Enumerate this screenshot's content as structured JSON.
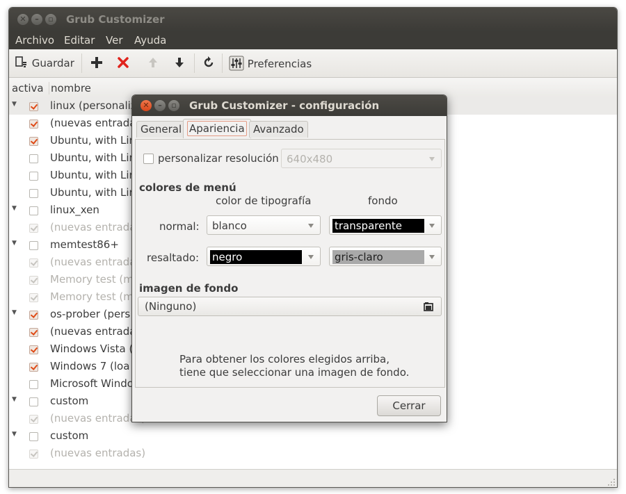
{
  "main_window": {
    "title": "Grub Customizer",
    "menu": [
      "Archivo",
      "Editar",
      "Ver",
      "Ayuda"
    ],
    "toolbar": {
      "save_label": "Guardar",
      "preferences_label": "Preferencias"
    },
    "columns": {
      "active": "activa",
      "name": "nombre"
    },
    "rows": [
      {
        "label": "linux (personaliz",
        "checked": true,
        "disabled": false,
        "expander": true
      },
      {
        "label": "(nuevas entrada",
        "checked": true,
        "disabled": false,
        "expander": false
      },
      {
        "label": "Ubuntu, with Lin",
        "checked": true,
        "disabled": false,
        "expander": false
      },
      {
        "label": "Ubuntu, with Lin",
        "checked": false,
        "disabled": false,
        "expander": false
      },
      {
        "label": "Ubuntu, with Lin",
        "checked": false,
        "disabled": false,
        "expander": false
      },
      {
        "label": "Ubuntu, with Lin",
        "checked": false,
        "disabled": false,
        "expander": false
      },
      {
        "label": "linux_xen",
        "checked": false,
        "disabled": false,
        "expander": true
      },
      {
        "label": "(nuevas entrada",
        "checked": true,
        "disabled": true,
        "expander": false
      },
      {
        "label": "memtest86+",
        "checked": false,
        "disabled": false,
        "expander": true
      },
      {
        "label": "(nuevas entrada",
        "checked": true,
        "disabled": true,
        "expander": false
      },
      {
        "label": "Memory test (m",
        "checked": true,
        "disabled": true,
        "expander": false
      },
      {
        "label": "Memory test (m",
        "checked": true,
        "disabled": true,
        "expander": false
      },
      {
        "label": "os-prober (pers",
        "checked": true,
        "disabled": false,
        "expander": true
      },
      {
        "label": "(nuevas entrada",
        "checked": true,
        "disabled": false,
        "expander": false
      },
      {
        "label": "Windows Vista (",
        "checked": true,
        "disabled": false,
        "expander": false
      },
      {
        "label": "Windows 7 (loa",
        "checked": true,
        "disabled": false,
        "expander": false
      },
      {
        "label": "Microsoft Windo",
        "checked": false,
        "disabled": false,
        "expander": false
      },
      {
        "label": "custom",
        "checked": false,
        "disabled": false,
        "expander": true
      },
      {
        "label": "(nuevas entradas)",
        "checked": true,
        "disabled": true,
        "expander": false
      },
      {
        "label": "custom",
        "checked": false,
        "disabled": false,
        "expander": true
      },
      {
        "label": "(nuevas entradas)",
        "checked": true,
        "disabled": true,
        "expander": false
      }
    ]
  },
  "dialog": {
    "title": "Grub Customizer - configuración",
    "tabs": [
      "General",
      "Apariencia",
      "Avanzado"
    ],
    "active_tab": "Apariencia",
    "custom_resolution": {
      "label": "personalizar resolución",
      "checked": false,
      "value": "640x480"
    },
    "menu_colors": {
      "heading": "colores de menú",
      "font_color_header": "color de tipografía",
      "background_header": "fondo",
      "normal_label": "normal:",
      "normal_font": "blanco",
      "normal_bg": "transparente",
      "highlight_label": "resaltado:",
      "highlight_font": "negro",
      "highlight_bg": "gris-claro"
    },
    "background_image": {
      "heading": "imagen de fondo",
      "value": "(Ninguno)"
    },
    "info_line1": "Para obtener los colores elegidos arriba,",
    "info_line2": "tiene que seleccionar una imagen de fondo.",
    "close_label": "Cerrar"
  },
  "colors": {
    "titlebar": "#3c3b37",
    "close_orange": "#e95420",
    "check_orange": "#df4a16",
    "swatch_black": "#000000",
    "swatch_gray": "#a9a9a9"
  }
}
